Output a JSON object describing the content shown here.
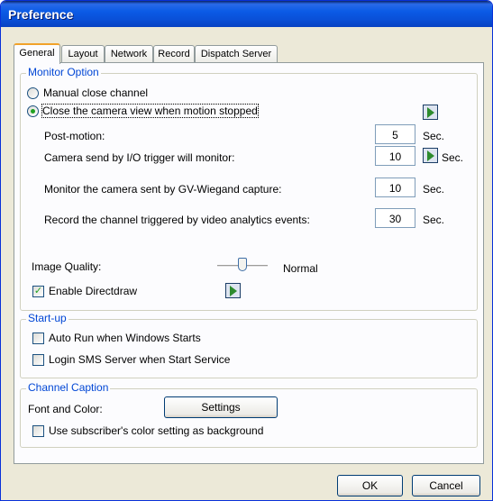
{
  "window": {
    "title": "Preference"
  },
  "tabs": [
    {
      "label": "General",
      "active": true
    },
    {
      "label": "Layout"
    },
    {
      "label": "Network"
    },
    {
      "label": "Record"
    },
    {
      "label": "Dispatch Server"
    }
  ],
  "monitor_option": {
    "legend": "Monitor Option",
    "manual_close_label": "Manual close channel",
    "close_on_motion_stop_label": "Close the camera view when motion stopped",
    "selected": "close_on_motion_stop",
    "post_motion": {
      "label": "Post-motion:",
      "value": "5",
      "unit": "Sec."
    },
    "io_trigger": {
      "label": "Camera send by I/O trigger will monitor:",
      "value": "10",
      "unit": "Sec."
    },
    "gv_wiegand": {
      "label": "Monitor the camera sent by GV-Wiegand capture:",
      "value": "10",
      "unit": "Sec."
    },
    "video_analytics": {
      "label": "Record the channel triggered by video analytics events:",
      "value": "30",
      "unit": "Sec."
    },
    "image_quality": {
      "label": "Image Quality:",
      "value_label": "Normal",
      "level": 0.5
    },
    "enable_directdraw": {
      "label": "Enable Directdraw",
      "checked": true
    }
  },
  "startup": {
    "legend": "Start-up",
    "auto_run": {
      "label": "Auto Run when Windows Starts",
      "checked": false
    },
    "login_sms": {
      "label": "Login SMS Server when Start Service",
      "checked": false
    }
  },
  "channel_caption": {
    "legend": "Channel Caption",
    "font_color_label": "Font and Color:",
    "settings_button": "Settings",
    "subscriber_color": {
      "label": "Use subscriber's color setting as background",
      "checked": false
    }
  },
  "footer": {
    "ok_label": "OK",
    "cancel_label": "Cancel"
  },
  "colors": {
    "title_bar": "#0A50D8",
    "legend_text": "#0046D5",
    "tab_highlight": "#F1A22A",
    "window_bg": "#ECE9D8"
  }
}
